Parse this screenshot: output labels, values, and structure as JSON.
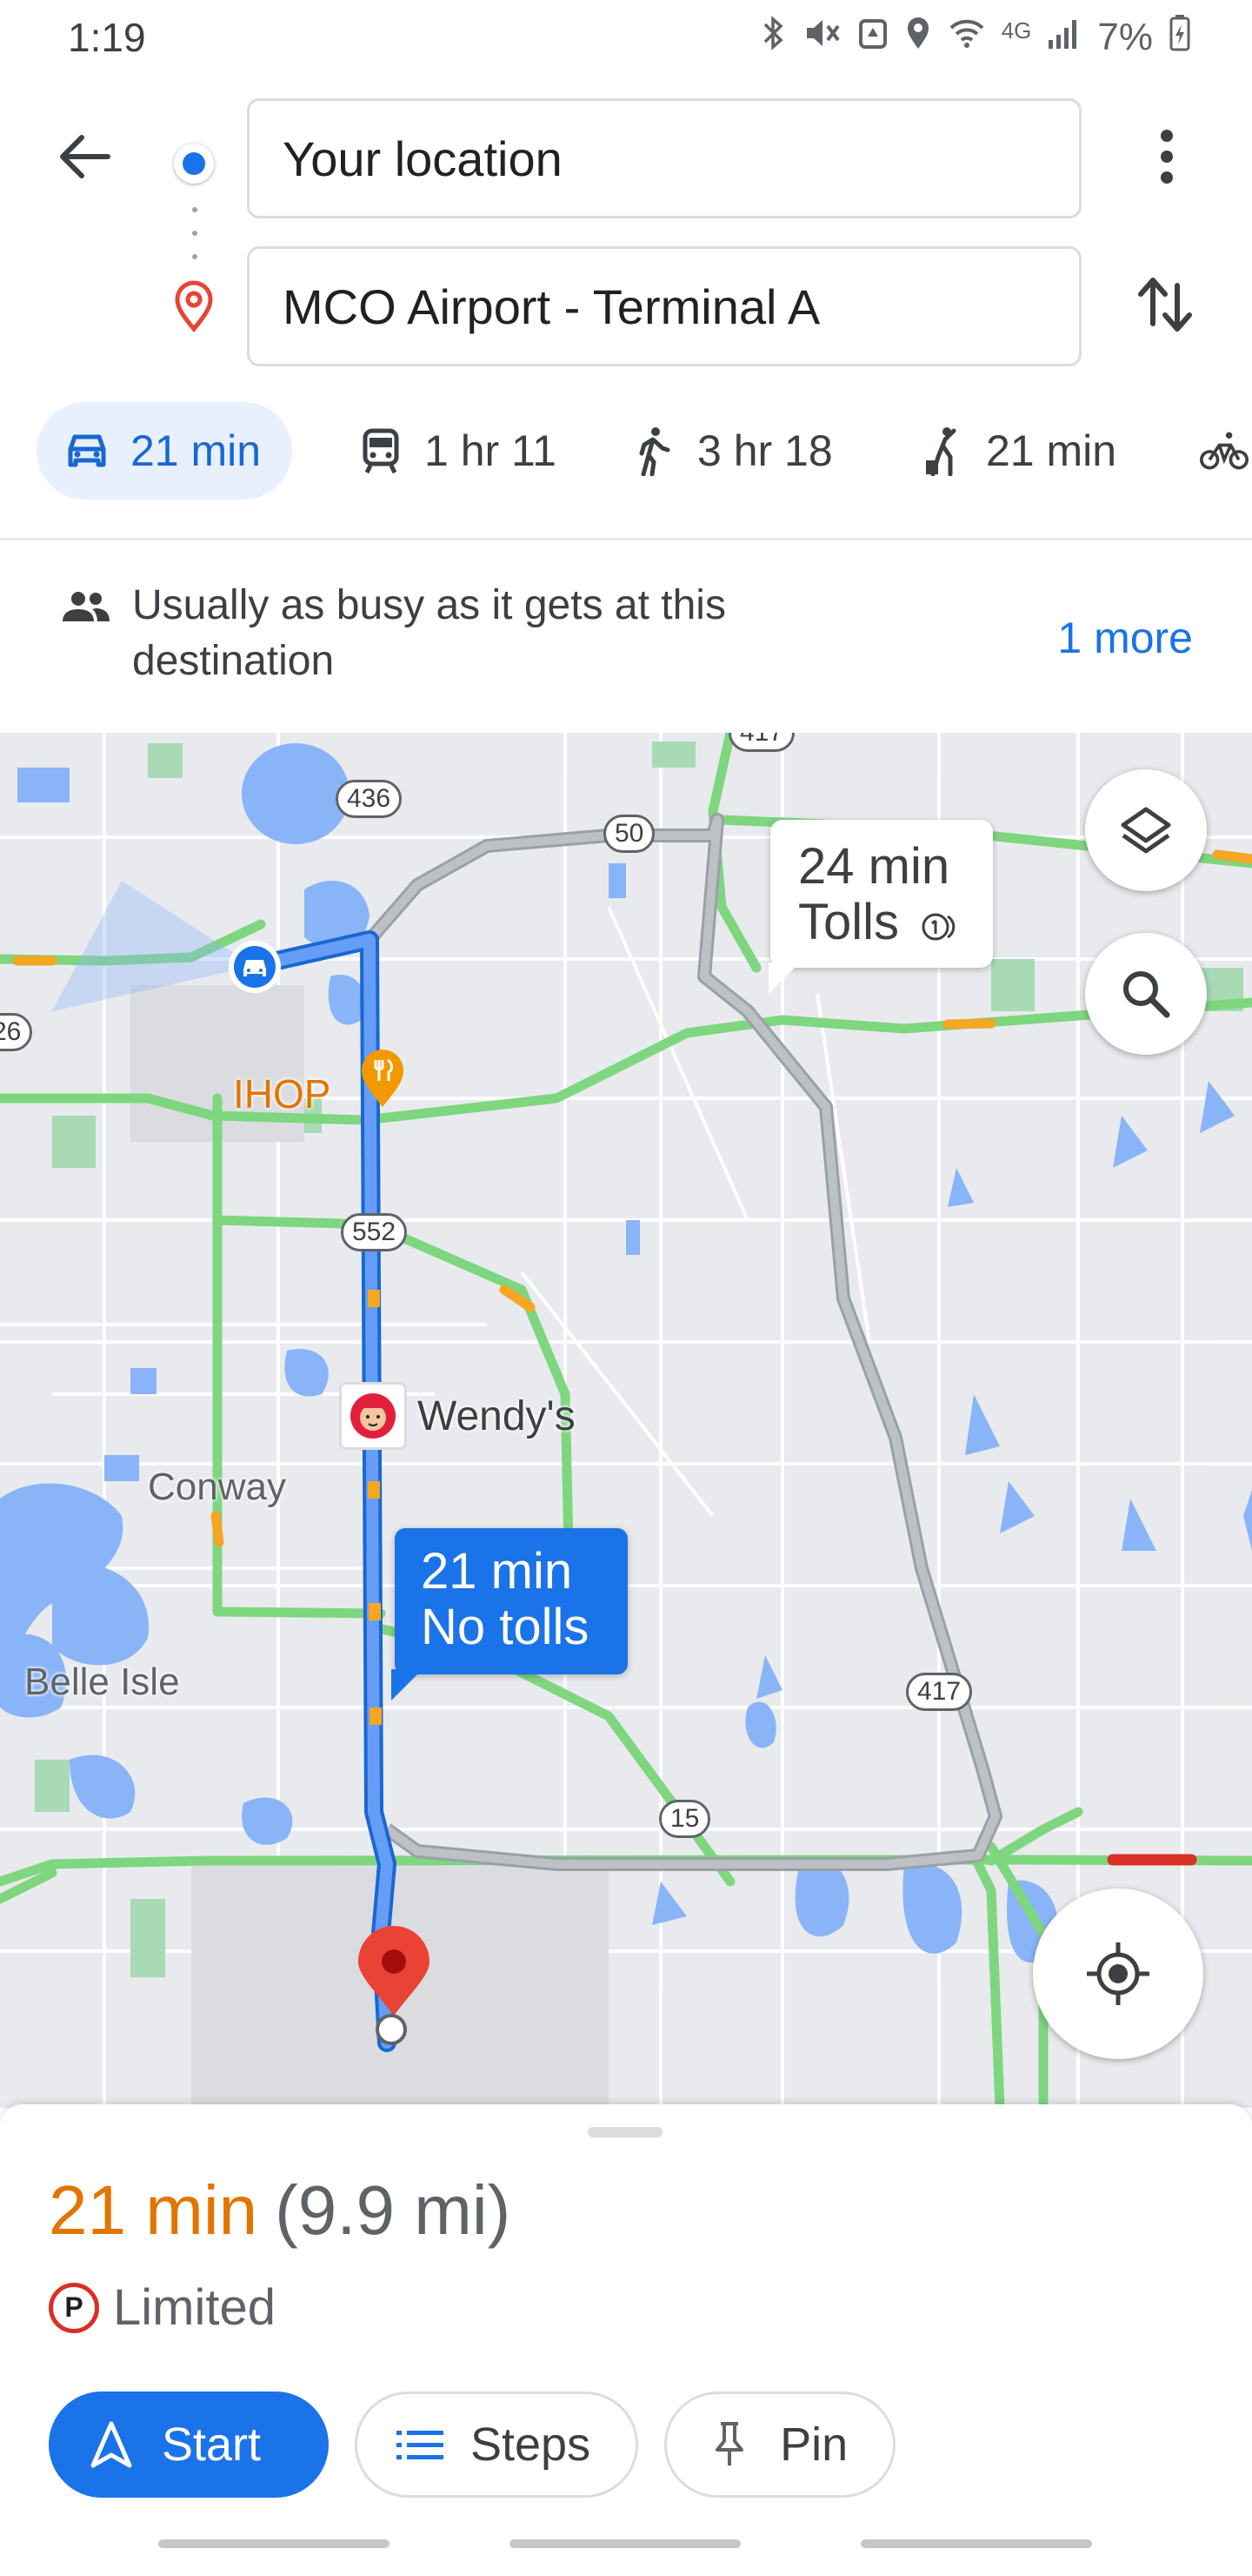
{
  "status_bar": {
    "time": "1:19",
    "network": "4G",
    "battery": "7%"
  },
  "search": {
    "origin_value": "Your location",
    "destination_value": "MCO Airport - Terminal A"
  },
  "travel_modes": [
    {
      "mode": "drive",
      "label": "21 min",
      "icon": "car-icon",
      "active": true
    },
    {
      "mode": "transit",
      "label": "1 hr 11",
      "icon": "train-icon",
      "active": false
    },
    {
      "mode": "walk",
      "label": "3 hr 18",
      "icon": "walk-icon",
      "active": false
    },
    {
      "mode": "ride",
      "label": "21 min",
      "icon": "ride-hail-icon",
      "active": false
    },
    {
      "mode": "bike",
      "label": "",
      "icon": "bike-icon",
      "active": false
    }
  ],
  "busy_info": {
    "text": "Usually as busy as it gets at this destination",
    "more_link": "1 more"
  },
  "map": {
    "alt_route_callout": {
      "time": "24 min",
      "note": "Tolls"
    },
    "main_route_callout": {
      "time": "21 min",
      "note": "No tolls"
    },
    "places": {
      "ihop": "IHOP",
      "wendys": "Wendy's",
      "conway": "Conway",
      "belle_isle": "Belle Isle"
    },
    "road_shields": {
      "sr436": "436",
      "sr50": "50",
      "sr552": "552",
      "sr417_top": "417",
      "sr417": "417",
      "sr15": "15",
      "left_edge": "26"
    }
  },
  "trip_summary": {
    "duration": "21 min",
    "distance": "(9.9 mi)",
    "parking": "Limited",
    "parking_badge": "P",
    "buttons": {
      "start": "Start",
      "steps": "Steps",
      "pin": "Pin"
    }
  },
  "colors": {
    "accent_blue": "#1a73e8",
    "traffic_green": "#7ed67e",
    "eta_orange": "#e37400",
    "destination_red": "#ea4335"
  }
}
